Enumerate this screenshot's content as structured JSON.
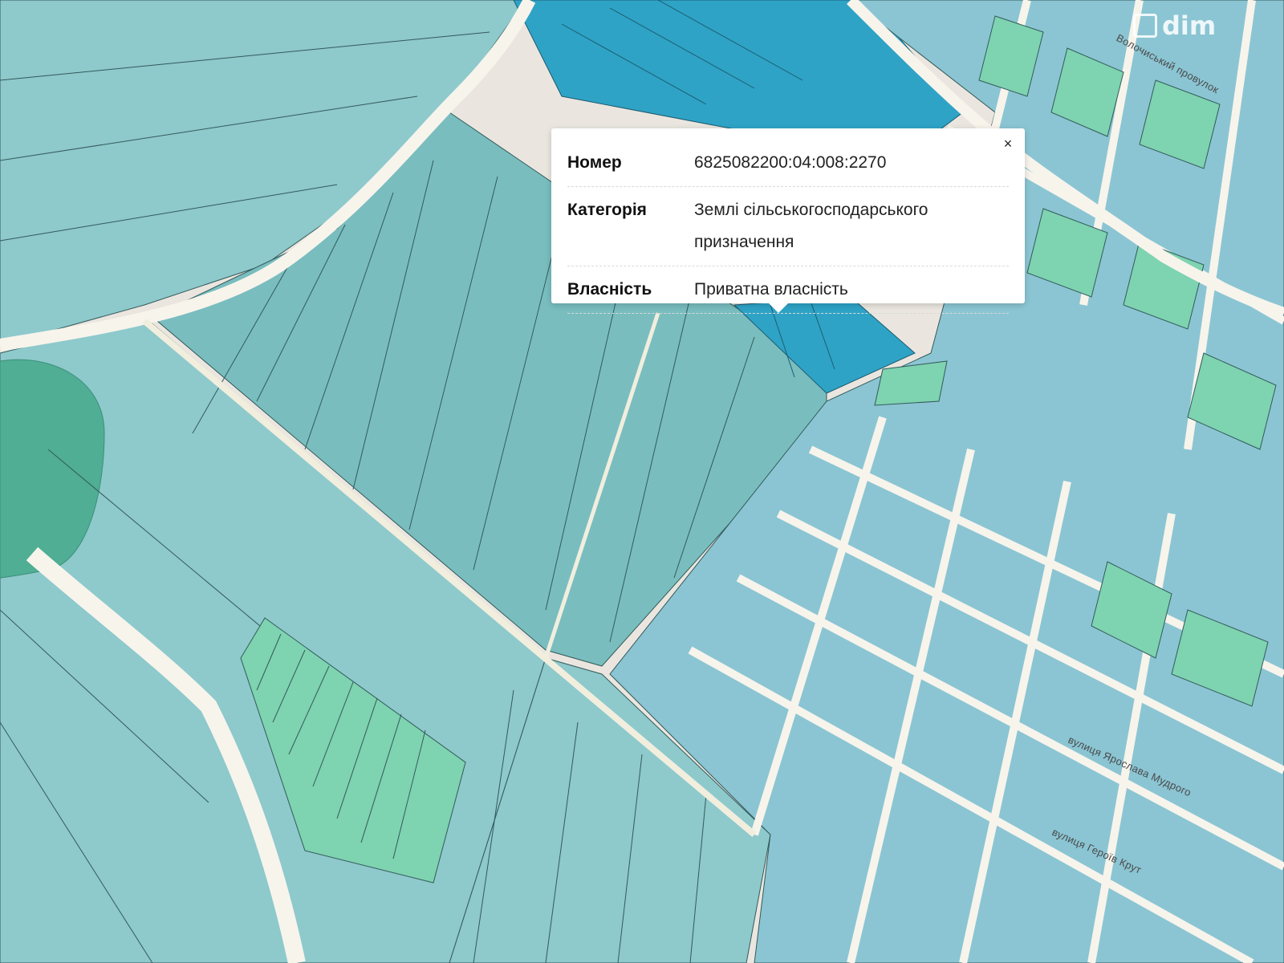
{
  "map": {
    "colors": {
      "background": "#eae6df",
      "agricultural_parcel": "#8ec9cc",
      "agricultural_parcel_dark": "#79bdbf",
      "residential_parcel": "#7ed3b0",
      "selected_parcel": "#2ea3c6",
      "private_parcel": "#8bc5d3",
      "forest": "#4fae93",
      "road": "#f7f4ec",
      "parcel_border": "#335a5a"
    },
    "streets": [
      "Волочиський провулок",
      "вулиця Ярослава Мудрого",
      "вулиця Героїв Крут"
    ]
  },
  "watermark": {
    "text": "dim",
    "icon": "home-icon"
  },
  "popup": {
    "rows": [
      {
        "key": "Номер",
        "value": "6825082200:04:008:2270"
      },
      {
        "key": "Категорія",
        "value": "Землі сільськогосподарського призначення"
      },
      {
        "key": "Власність",
        "value": "Приватна власність"
      }
    ],
    "close_label": "×"
  }
}
